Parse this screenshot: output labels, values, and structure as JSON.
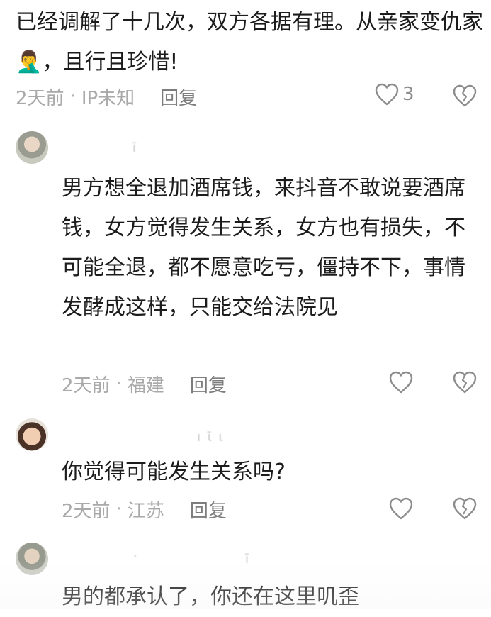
{
  "top_comment": {
    "text": "已经调解了十几次，双方各据有理。从亲家变仇家🤦‍♂️，且行且珍惜!",
    "time": "2天前",
    "location": "IP未知",
    "reply_label": "回复",
    "like_count": "3"
  },
  "replies": [
    {
      "text": "男方想全退加酒席钱，来抖音不敢说要酒席钱，女方觉得发生关系，女方也有损失，不可能全退，都不愿意吃亏，僵持不下，事情发酵成这样，只能交给法院见",
      "time": "2天前",
      "location": "福建",
      "reply_label": "回复"
    },
    {
      "text": "你觉得可能发生关系吗?",
      "time": "2天前",
      "location": "江苏",
      "reply_label": "回复"
    },
    {
      "text": "男的都承认了，你还在这里叽歪"
    }
  ],
  "separator": "·",
  "icons": {
    "like": "heart-outline-icon",
    "dislike": "broken-heart-icon"
  },
  "colors": {
    "text": "#1c1c1c",
    "meta": "#a9a9a9",
    "reply": "#7d7d7d",
    "icon": "#8c8c8c"
  }
}
